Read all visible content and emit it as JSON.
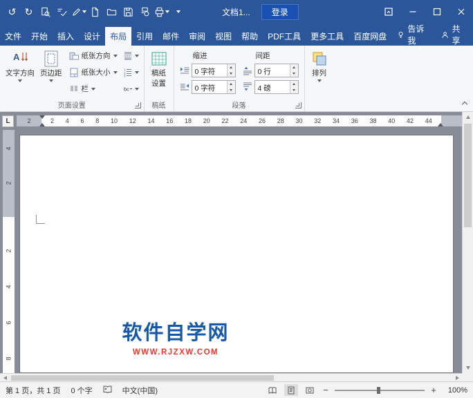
{
  "titlebar": {
    "doc_title": "文档1...",
    "login": "登录"
  },
  "icons": {
    "undo": "↺",
    "redo": "↻",
    "zoom_out": "−",
    "zoom_in": "+"
  },
  "tabs": {
    "file": "文件",
    "home": "开始",
    "insert": "插入",
    "design": "设计",
    "layout": "布局",
    "references": "引用",
    "mailings": "邮件",
    "review": "审阅",
    "view": "视图",
    "help": "帮助",
    "pdf_tools": "PDF工具",
    "more_tools": "更多工具",
    "baidu_pan": "百度网盘",
    "tell_me": "告诉我",
    "share": "共享"
  },
  "ribbon": {
    "page_setup": {
      "group_label": "页面设置",
      "text_direction": "文字方向",
      "margins": "页边距",
      "orientation": "纸张方向",
      "paper_size": "纸张大小",
      "columns": "栏"
    },
    "manuscript": {
      "group_label": "稿纸",
      "button_line1": "稿纸",
      "button_line2": "设置"
    },
    "paragraph": {
      "group_label": "段落",
      "indent_label": "缩进",
      "spacing_label": "间距",
      "indent_left": "0 字符",
      "indent_right": "0 字符",
      "spacing_before": "0 行",
      "spacing_after": "4 磅"
    },
    "arrange": {
      "label": "排列"
    }
  },
  "ruler": {
    "tab_selector": "L",
    "h_margin_number": "2",
    "h_numbers": [
      "2",
      "4",
      "6",
      "8",
      "10",
      "12",
      "14",
      "16",
      "18",
      "20",
      "22",
      "24",
      "26",
      "28",
      "30",
      "32",
      "34",
      "36",
      "38",
      "40",
      "42",
      "44"
    ],
    "v_top_numbers": [
      "4",
      "2"
    ],
    "v_numbers": [
      "2",
      "4",
      "6",
      "8"
    ]
  },
  "document": {
    "watermark_title": "软件自学网",
    "watermark_url": "WWW.RJZXW.COM"
  },
  "statusbar": {
    "page_info": "第 1 页，共 1 页",
    "word_count": "0 个字",
    "language": "中文(中国)",
    "zoom_level": "100%"
  },
  "colors": {
    "titlebar_blue": "#2b579a",
    "login_button_blue": "#1850b4",
    "watermark_blue": "#1758a7",
    "watermark_red": "#ea3b2e",
    "canvas_gray": "#878c96"
  }
}
